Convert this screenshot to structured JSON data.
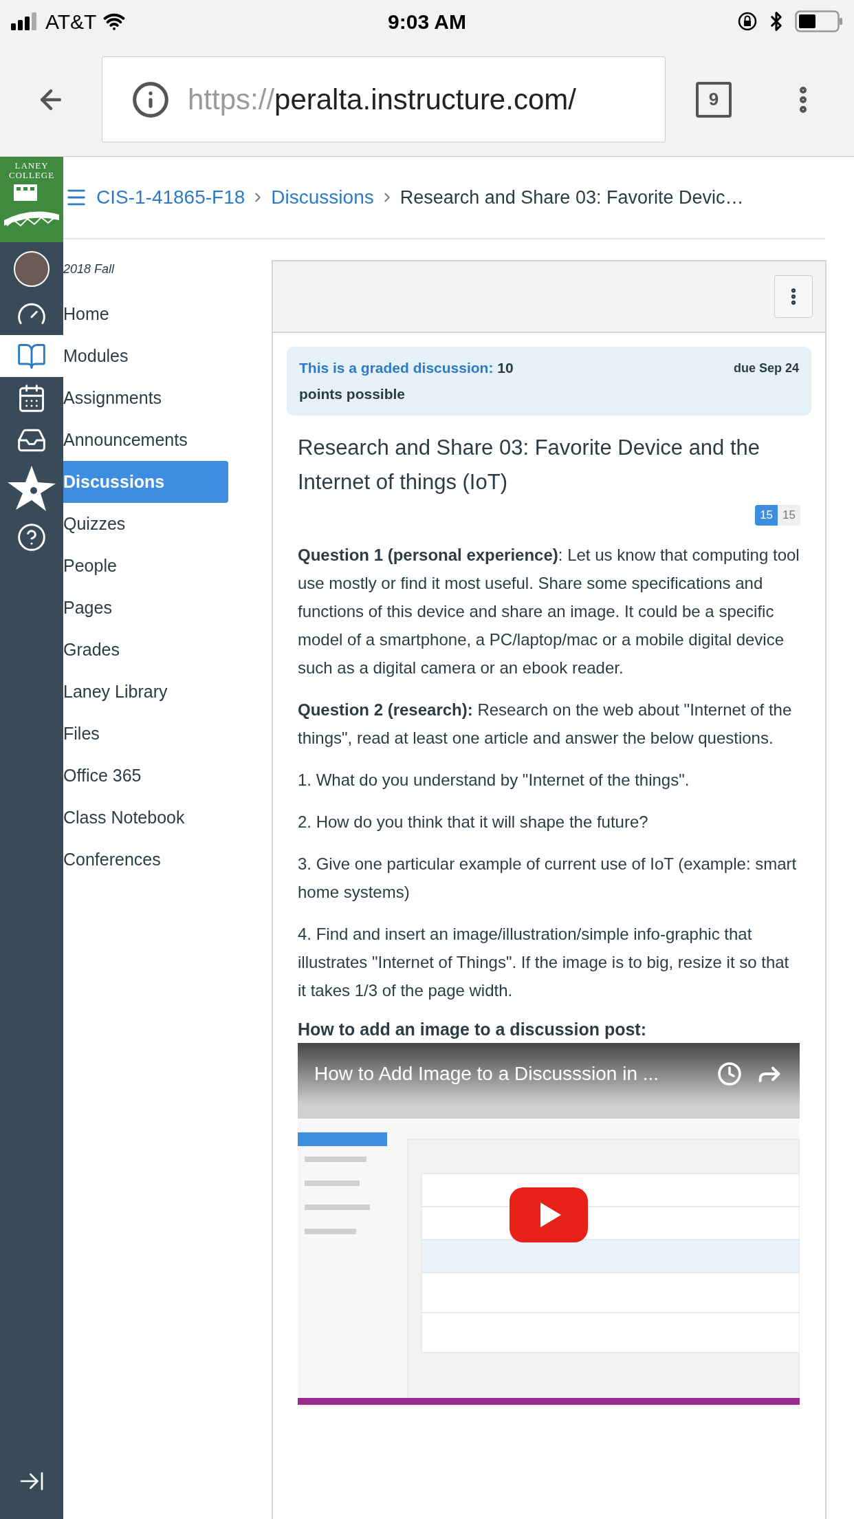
{
  "status_bar": {
    "carrier": "AT&T",
    "time": "9:03 AM"
  },
  "browser": {
    "url_scheme": "https://",
    "url_host": "peralta.instructure.com/",
    "tab_count": "9"
  },
  "logo": {
    "lines": [
      "LANEY",
      "COLLEGE"
    ]
  },
  "global_nav": [
    {
      "kind": "dashboard",
      "selected": false
    },
    {
      "kind": "courses",
      "selected": true
    },
    {
      "kind": "calendar",
      "selected": false
    },
    {
      "kind": "inbox",
      "selected": false
    },
    {
      "kind": "star",
      "selected": false
    },
    {
      "kind": "help",
      "selected": false
    }
  ],
  "breadcrumb": [
    {
      "label": "CIS-1-41865-F18",
      "link": true
    },
    {
      "label": "Discussions",
      "link": true
    },
    {
      "label": "Research and Share 03: Favorite Devic…",
      "link": false
    }
  ],
  "course_nav": {
    "term": "2018 Fall",
    "items": [
      {
        "label": "Home",
        "selected": false
      },
      {
        "label": "Modules",
        "selected": false
      },
      {
        "label": "Assignments",
        "selected": false
      },
      {
        "label": "Announcements",
        "selected": false
      },
      {
        "label": "Discussions",
        "selected": true
      },
      {
        "label": "Quizzes",
        "selected": false
      },
      {
        "label": "People",
        "selected": false
      },
      {
        "label": "Pages",
        "selected": false
      },
      {
        "label": "Grades",
        "selected": false
      },
      {
        "label": "Laney Library",
        "selected": false
      },
      {
        "label": "Files",
        "selected": false
      },
      {
        "label": "Office 365",
        "selected": false
      },
      {
        "label": "Class Notebook",
        "selected": false
      },
      {
        "label": "Conferences",
        "selected": false
      }
    ]
  },
  "discussion": {
    "graded_label": "This is a graded discussion:",
    "points": "10 points possible",
    "due": "due Sep 24",
    "title": "Research and Share 03: Favorite Device and the Internet of things (IoT)",
    "unread_count": "15",
    "total_count": "15",
    "paragraphs": [
      "**Question 1 (personal experience)**: Let us know that computing tool use mostly or find it most useful. Share some specifications and functions of this device and share an image. It could be a specific model of a smartphone, a PC/laptop/mac or a mobile digital device such as a digital camera or an ebook reader.",
      "**Question 2 (research):** Research on the web about \"Internet of the things\", read at least one article and answer the below questions.",
      "1. What do you understand by \"Internet of the things\".",
      "2. How do  you think that it will shape the future?",
      "3. Give one particular example of current use of IoT (example: smart home systems)",
      "4. Find and insert an image/illustration/simple info-graphic that illustrates \"Internet of Things\". If the image is to big, resize it so that it takes 1/3 of the page width."
    ],
    "video_heading": "How to add an image to a discussion post:",
    "video": {
      "kind": "picture",
      "title": "How to Add Image to a Discusssion in ..."
    }
  }
}
